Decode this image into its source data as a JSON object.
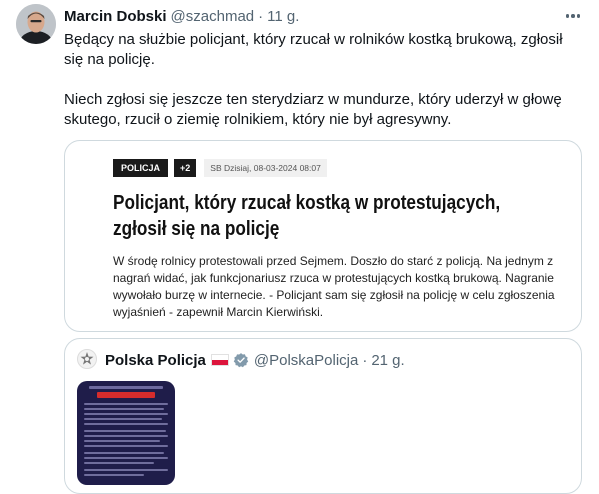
{
  "tweet": {
    "author_name": "Marcin Dobski",
    "author_handle": "@szachmad",
    "separator": "·",
    "time": "11 g.",
    "text_paragraph_1": "Będący na służbie policjant, który rzucał w rolników kostką brukową, zgłosił się na policję.",
    "text_paragraph_2": "Niech zgłosi się jeszcze ten sterydziarz w mundurze, który uderzył w głowę skutego, rzucił o ziemię rolnikiem, który nie był agresywny.",
    "icons": {
      "avatar": "avatar-photo",
      "more": "more-options-icon"
    }
  },
  "article_card": {
    "category": "POLICJA",
    "extra_count": "+2",
    "source_and_date": "SB Dzisiaj, 08-03-2024 08:07",
    "headline": "Policjant, który rzucał kostką w protestujących, zgłosił się na policję",
    "summary": "W środę rolnicy protestowali przed Sejmem. Doszło do starć z policją. Na jednym z nagrań widać, jak funkcjonariusz rzuca w protestujących kostką brukową. Nagranie wywołało burzę w internecie. - Policjant sam się zgłosił na policję w celu zgłoszenia wyjaśnień - zapewnił Marcin Kierwiński."
  },
  "quoted_tweet": {
    "author_name": "Polska Policja",
    "author_handle": "@PolskaPolicja",
    "separator": "·",
    "time": "21 g.",
    "icons": {
      "avatar": "police-star-logo",
      "flag": "poland-flag-icon",
      "badge": "verified-badge-icon",
      "media": "communique-image"
    },
    "colors": {
      "verified": "#829aab",
      "flag_red": "#dc143c"
    }
  }
}
